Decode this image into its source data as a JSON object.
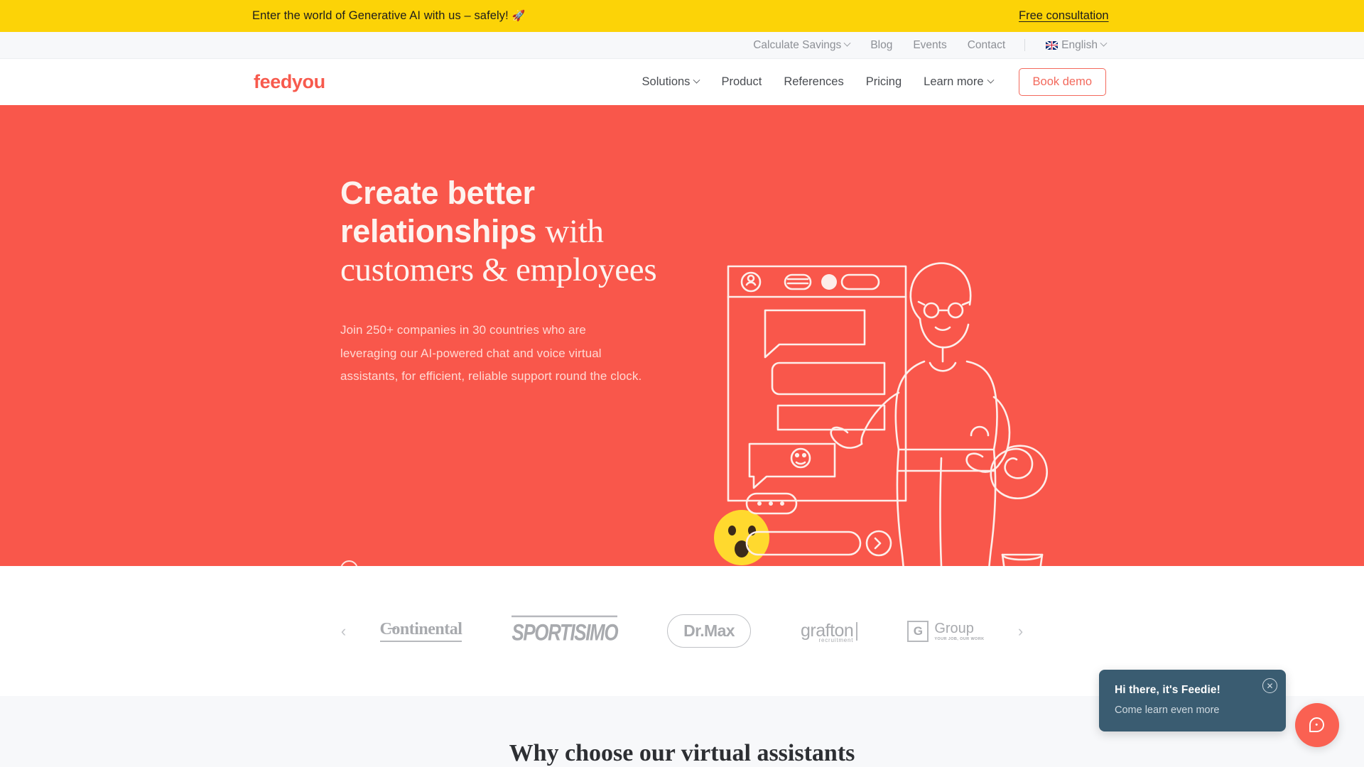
{
  "announcement": {
    "text": "Enter the world of Generative AI with us – safely!",
    "emoji": "🚀",
    "cta": "Free consultation"
  },
  "utility_nav": {
    "items": [
      {
        "label": "Calculate Savings",
        "has_caret": true
      },
      {
        "label": "Blog",
        "has_caret": false
      },
      {
        "label": "Events",
        "has_caret": false
      },
      {
        "label": "Contact",
        "has_caret": false
      }
    ],
    "language": {
      "label": "English",
      "flag": "uk-flag-icon"
    }
  },
  "header": {
    "logo": "feedyou",
    "nav": [
      {
        "label": "Solutions",
        "has_caret": true
      },
      {
        "label": "Product",
        "has_caret": false
      },
      {
        "label": "References",
        "has_caret": false
      },
      {
        "label": "Pricing",
        "has_caret": false
      },
      {
        "label": "Learn more",
        "has_caret": true
      }
    ],
    "cta": "Book demo"
  },
  "hero": {
    "heading_bold": "Create better relationships",
    "heading_serif": "with customers & employees",
    "subtext": "Join 250+ companies in 30 countries who are leveraging our AI-powered chat and voice virtual assistants, for efficient, reliable support round the clock.",
    "scroll_hint": "scroll-indicator",
    "background_color": "#f9574b"
  },
  "clients": {
    "prev": "‹",
    "next": "›",
    "logos": [
      {
        "name": "Continental",
        "text": "C̶ontinental"
      },
      {
        "name": "Sportisimo",
        "text": "SPORTISIMO"
      },
      {
        "name": "Dr.Max",
        "text": "Dr.Max"
      },
      {
        "name": "Grafton Recruitment",
        "text": "grafton",
        "sub": "recruitment"
      },
      {
        "name": "Gi Group",
        "text": "Group",
        "sub": "YOUR JOB, OUR WORK",
        "mark": "G"
      }
    ]
  },
  "next_section": {
    "title": "Why choose our virtual assistants"
  },
  "chat_widget": {
    "title": "Hi there, it's Feedie!",
    "subtitle": "Come learn even more",
    "close_icon": "close-icon",
    "fab_icon": "chat-bubble-icon",
    "accent": "#fa6152",
    "panel_color": "#3a5c71"
  }
}
